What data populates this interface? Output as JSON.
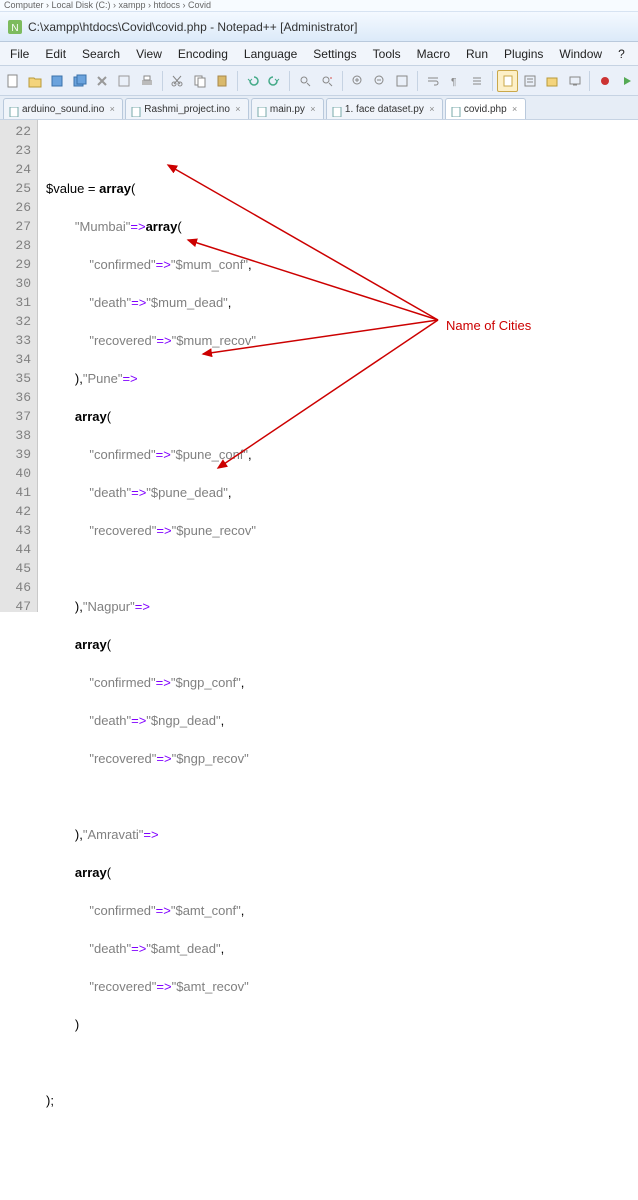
{
  "breadcrumbs": "Computer › Local Disk (C:) › xampp › htdocs › Covid",
  "window": {
    "title": "C:\\xampp\\htdocs\\Covid\\covid.php - Notepad++ [Administrator]"
  },
  "menu": {
    "file": "File",
    "edit": "Edit",
    "search": "Search",
    "view": "View",
    "encoding": "Encoding",
    "language": "Language",
    "settings": "Settings",
    "tools": "Tools",
    "macro": "Macro",
    "run": "Run",
    "plugins": "Plugins",
    "window": "Window",
    "help": "?"
  },
  "tabs": {
    "t0": "arduino_sound.ino",
    "t1": "Rashmi_project.ino",
    "t2": "main.py",
    "t3": "1. face dataset.py",
    "t4": "covid.php"
  },
  "gutter": {
    "l22": "22",
    "l23": "23",
    "l24": "24",
    "l25": "25",
    "l26": "26",
    "l27": "27",
    "l28": "28",
    "l29": "29",
    "l30": "30",
    "l31": "31",
    "l32": "32",
    "l33": "33",
    "l34": "34",
    "l35": "35",
    "l36": "36",
    "l37": "37",
    "l38": "38",
    "l39": "39",
    "l40": "40",
    "l41": "41",
    "l42": "42",
    "l43": "43",
    "l44": "44",
    "l45": "45",
    "l46": "46",
    "l47": "47"
  },
  "code": {
    "l23_var": "$value ",
    "l23_eq": "= ",
    "l23_array": "array",
    "l23_paren": "(",
    "l24_ind": "        ",
    "l24_mum": "\"Mumbai\"",
    "l24_arrow": "=>",
    "l24_array": "array",
    "l24_paren": "(",
    "l25_ind": "            ",
    "l25_k": "\"confirmed\"",
    "l25_arrow": "=>",
    "l25_v": "\"$mum_conf\"",
    "l25_c": ",",
    "l26_ind": "            ",
    "l26_k": "\"death\"",
    "l26_arrow": "=>",
    "l26_v": "\"$mum_dead\"",
    "l26_c": ",",
    "l27_ind": "            ",
    "l27_k": "\"recovered\"",
    "l27_arrow": "=>",
    "l27_v": "\"$mum_recov\"",
    "l28_ind": "        ",
    "l28_close": "),",
    "l28_pune": "\"Pune\"",
    "l28_arrow": "=>",
    "l29_ind": "        ",
    "l29_array": "array",
    "l29_paren": "(",
    "l30_ind": "            ",
    "l30_k": "\"confirmed\"",
    "l30_arrow": "=>",
    "l30_v": "\"$pune_conf\"",
    "l30_c": ",",
    "l31_ind": "            ",
    "l31_k": "\"death\"",
    "l31_arrow": "=>",
    "l31_v": "\"$pune_dead\"",
    "l31_c": ",",
    "l32_ind": "            ",
    "l32_k": "\"recovered\"",
    "l32_arrow": "=>",
    "l32_v": "\"$pune_recov\"",
    "l33_blank": "",
    "l34_ind": "        ",
    "l34_close": "),",
    "l34_ngp": "\"Nagpur\"",
    "l34_arrow": "=>",
    "l35_ind": "        ",
    "l35_array": "array",
    "l35_paren": "(",
    "l36_ind": "            ",
    "l36_k": "\"confirmed\"",
    "l36_arrow": "=>",
    "l36_v": "\"$ngp_conf\"",
    "l36_c": ",",
    "l37_ind": "            ",
    "l37_k": "\"death\"",
    "l37_arrow": "=>",
    "l37_v": "\"$ngp_dead\"",
    "l37_c": ",",
    "l38_ind": "            ",
    "l38_k": "\"recovered\"",
    "l38_arrow": "=>",
    "l38_v": "\"$ngp_recov\"",
    "l39_blank": "",
    "l40_ind": "        ",
    "l40_close": "),",
    "l40_amt": "\"Amravati\"",
    "l40_arrow": "=>",
    "l41_ind": "        ",
    "l41_array": "array",
    "l41_paren": "(",
    "l42_ind": "            ",
    "l42_k": "\"confirmed\"",
    "l42_arrow": "=>",
    "l42_v": "\"$amt_conf\"",
    "l42_c": ",",
    "l43_ind": "            ",
    "l43_k": "\"death\"",
    "l43_arrow": "=>",
    "l43_v": "\"$amt_dead\"",
    "l43_c": ",",
    "l44_ind": "            ",
    "l44_k": "\"recovered\"",
    "l44_arrow": "=>",
    "l44_v": "\"$amt_recov\"",
    "l45_ind": "        ",
    "l45_close": ")",
    "l47_close": ");"
  },
  "annotation": {
    "label": "Name of Cities"
  }
}
